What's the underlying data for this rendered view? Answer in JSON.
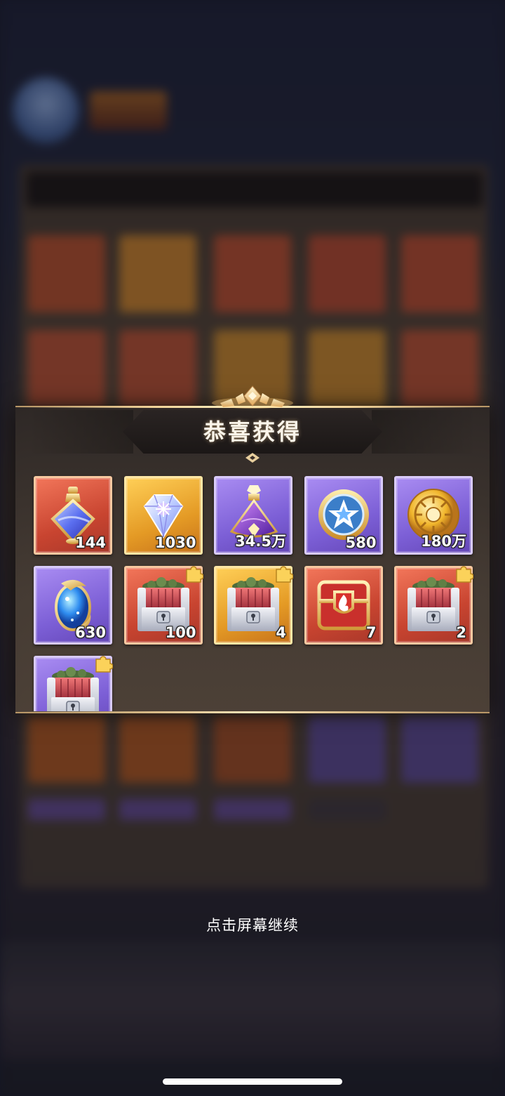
{
  "dialog": {
    "title": "恭喜获得",
    "hint": "点击屏幕继续"
  },
  "colors": {
    "red_rarity": "#d9553d",
    "gold_rarity": "#f0ad32",
    "purple_rarity": "#8a6ee0",
    "frame_gold": "#b89666"
  },
  "items": [
    {
      "icon": "blue-potion-icon",
      "rarity": "red",
      "quantity": "144"
    },
    {
      "icon": "diamond-gem-icon",
      "rarity": "gold",
      "quantity": "1030"
    },
    {
      "icon": "purple-potion-icon",
      "rarity": "purple",
      "quantity": "34.5万"
    },
    {
      "icon": "star-coin-icon",
      "rarity": "purple",
      "quantity": "580"
    },
    {
      "icon": "gold-coin-icon",
      "rarity": "purple",
      "quantity": "180万"
    },
    {
      "icon": "blue-crystal-icon",
      "rarity": "purple",
      "quantity": "630"
    },
    {
      "icon": "treasure-chest-icon",
      "rarity": "red",
      "quantity": "100",
      "badge": "puzzle-piece-icon"
    },
    {
      "icon": "treasure-chest-icon",
      "rarity": "gold",
      "quantity": "4",
      "badge": "puzzle-piece-icon"
    },
    {
      "icon": "fire-chest-icon",
      "rarity": "red",
      "quantity": "7"
    },
    {
      "icon": "treasure-chest-icon",
      "rarity": "red",
      "quantity": "2",
      "badge": "puzzle-piece-icon"
    },
    {
      "icon": "treasure-chest-icon",
      "rarity": "purple",
      "quantity": "",
      "badge": "puzzle-piece-icon"
    }
  ]
}
